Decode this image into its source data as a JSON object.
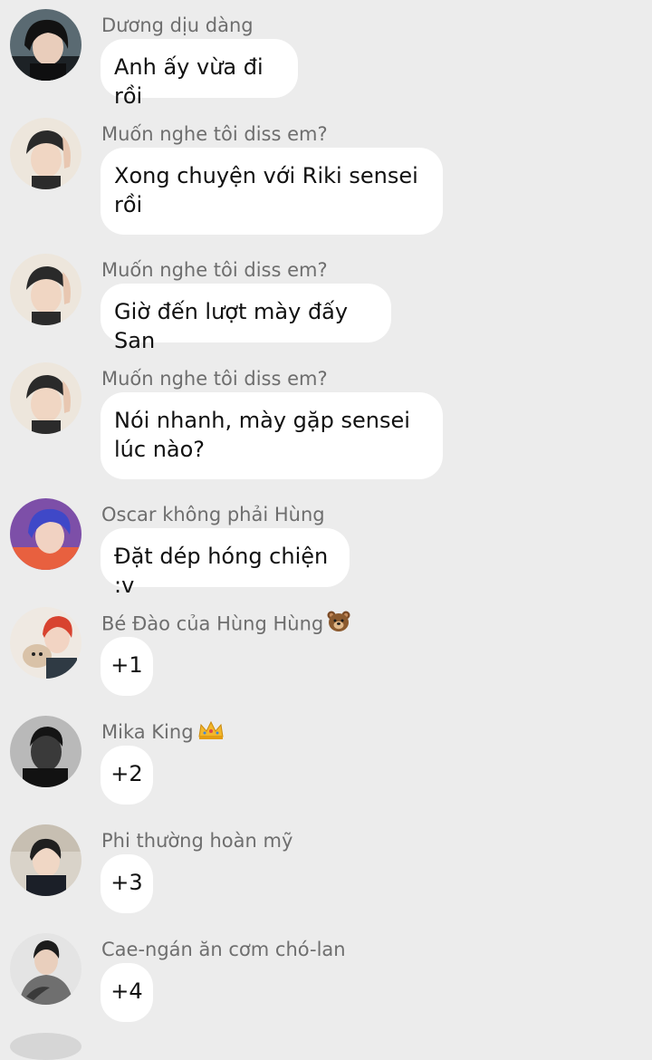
{
  "messages": [
    {
      "sender": "Dương dịu dàng",
      "text": "Anh ấy vừa đi rồi",
      "avatar": "avatar-dark-hair"
    },
    {
      "sender": "Muốn nghe tôi diss em?",
      "text": "Xong chuyện với Riki sensei rồi",
      "avatar": "avatar-beanie"
    },
    {
      "sender": "Muốn nghe tôi diss em?",
      "text": "Giờ đến lượt mày đấy San",
      "avatar": "avatar-beanie"
    },
    {
      "sender": "Muốn nghe tôi diss em?",
      "text": "Nói nhanh, mày gặp sensei lúc nào?",
      "avatar": "avatar-beanie"
    },
    {
      "sender": "Oscar không phải Hùng",
      "text": "Đặt dép hóng chiện :v",
      "avatar": "avatar-purple-hair"
    },
    {
      "sender": "Bé Đào của Hùng Hùng",
      "sender_emoji": "bear-emoji",
      "text": "+1",
      "avatar": "avatar-with-dog"
    },
    {
      "sender": "Mika King",
      "sender_emoji": "crown-emoji",
      "text": "+2",
      "avatar": "avatar-buzzcut"
    },
    {
      "sender": "Phi thường hoàn mỹ",
      "text": "+3",
      "avatar": "avatar-room"
    },
    {
      "sender": "Cae-ngán ăn cơm chó-lan",
      "text": "+4",
      "avatar": "avatar-hoodie"
    }
  ],
  "colors": {
    "background": "#ececec",
    "bubble": "#ffffff",
    "sender_name": "#6e6e6e",
    "message_text": "#111111"
  }
}
